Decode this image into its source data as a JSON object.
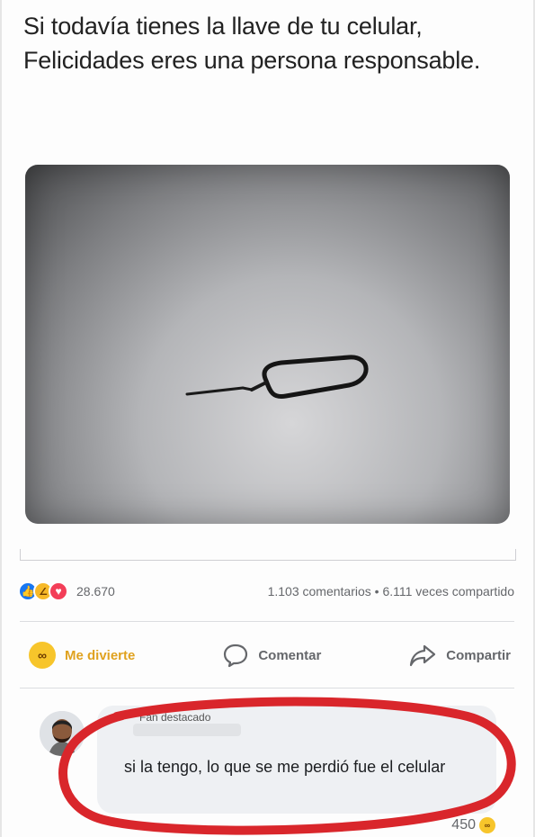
{
  "post": {
    "text": "Si todavía tienes la llave de tu celular, Felicidades eres una persona responsable."
  },
  "stats": {
    "reactions_count": "28.670",
    "comments_shares": "1.103 comentarios • 6.111 veces compartido"
  },
  "actions": [
    {
      "label": "Me divierte",
      "icon": "haha-icon"
    },
    {
      "label": "Comentar",
      "icon": "comment-icon"
    },
    {
      "label": "Compartir",
      "icon": "share-icon"
    }
  ],
  "comment": {
    "badge": "Fan destacado",
    "text": "si la tengo, lo que se me perdió fue el celular",
    "reaction_count": "450"
  },
  "colors": {
    "like": "#1877f2",
    "haha": "#f7c52b",
    "love": "#f33e58",
    "highlight_ring": "#d9262b"
  }
}
